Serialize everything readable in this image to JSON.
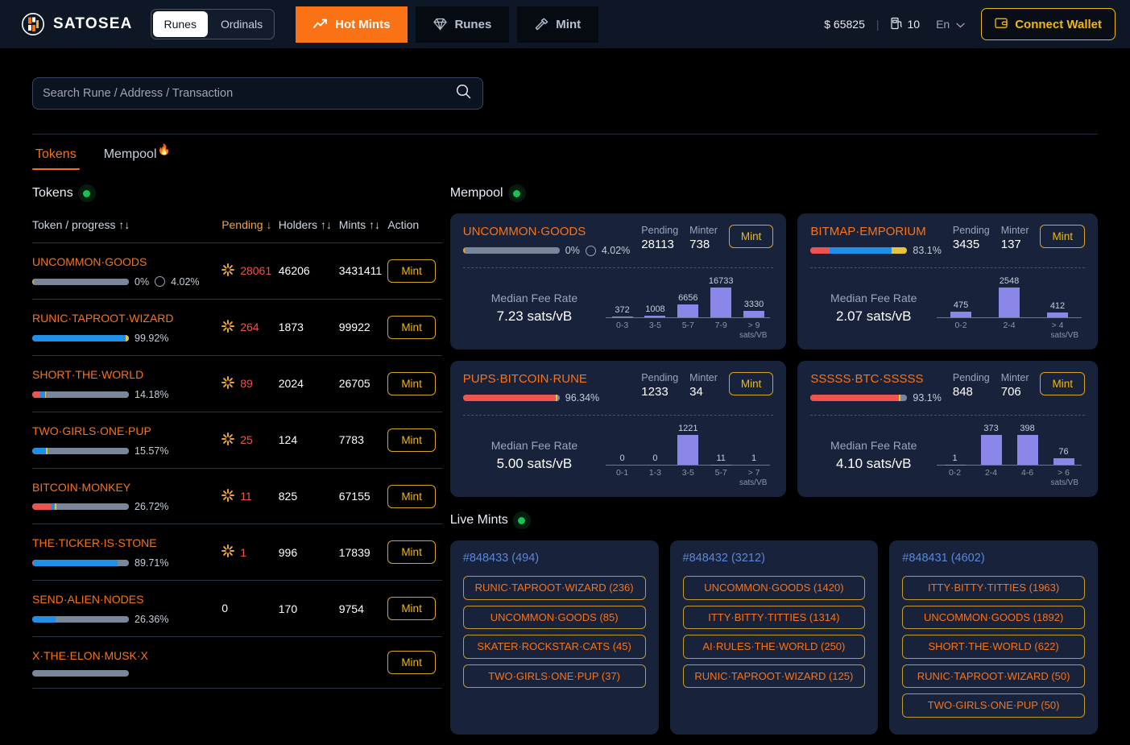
{
  "header": {
    "brand": "SATOSEA",
    "segments": [
      {
        "label": "Runes",
        "active": true
      },
      {
        "label": "Ordinals",
        "active": false
      }
    ],
    "nav": [
      {
        "label": "Hot Mints",
        "icon": "trend-up-icon",
        "active": true
      },
      {
        "label": "Runes",
        "icon": "diamond-icon",
        "active": false
      },
      {
        "label": "Mint",
        "icon": "hammer-icon",
        "active": false
      }
    ],
    "price": "$ 65825",
    "divider": "|",
    "gas": "10",
    "lang": "En",
    "wallet": "Connect Wallet",
    "accent": "#f97316",
    "wallet_color": "#f0b90b"
  },
  "search": {
    "placeholder": "Search Rune / Address / Transaction",
    "value": ""
  },
  "tabs": [
    {
      "label": "Tokens",
      "active": true,
      "flame": ""
    },
    {
      "label": "Mempool",
      "active": false,
      "flame": "🔥"
    }
  ],
  "tokens_panel": {
    "title": "Tokens",
    "columns": [
      {
        "label": "Token / progress",
        "sort": "↑↓",
        "sorted": false
      },
      {
        "label": "Pending",
        "sort": "↓",
        "sorted": true
      },
      {
        "label": "Holders",
        "sort": "↑↓",
        "sorted": false
      },
      {
        "label": "Mints",
        "sort": "↑↓",
        "sorted": false
      },
      {
        "label": "Action",
        "sort": "",
        "sorted": false
      }
    ],
    "action_label": "Mint",
    "rows": [
      {
        "name": "UNCOMMON·GOODS",
        "progress": "0%",
        "extra": "4.02%",
        "has_ring": true,
        "segments": [
          {
            "color": "#e8a33d",
            "pct": 1.5
          },
          {
            "color": "#7a8699",
            "pct": 98.5
          }
        ],
        "pending": "28061",
        "pending_zero": false,
        "holders": "46206",
        "mints": "3431411"
      },
      {
        "name": "RUNIC·TAPROOT·WIZARD",
        "progress": "99.92%",
        "extra": "",
        "has_ring": false,
        "segments": [
          {
            "color": "#1f8fe8",
            "pct": 97
          },
          {
            "color": "#e8c13d",
            "pct": 3
          }
        ],
        "pending": "264",
        "pending_zero": false,
        "holders": "1873",
        "mints": "99922"
      },
      {
        "name": "SHORT·THE·WORLD",
        "progress": "14.18%",
        "extra": "",
        "has_ring": false,
        "segments": [
          {
            "color": "#ef5350",
            "pct": 8
          },
          {
            "color": "#1f8fe8",
            "pct": 5
          },
          {
            "color": "#e8c13d",
            "pct": 1.5
          },
          {
            "color": "#7a8699",
            "pct": 85.5
          }
        ],
        "pending": "89",
        "pending_zero": false,
        "holders": "2024",
        "mints": "26705"
      },
      {
        "name": "TWO·GIRLS·ONE·PUP",
        "progress": "15.57%",
        "extra": "",
        "has_ring": false,
        "segments": [
          {
            "color": "#1f8fe8",
            "pct": 14
          },
          {
            "color": "#e8c13d",
            "pct": 2
          },
          {
            "color": "#7a8699",
            "pct": 84
          }
        ],
        "pending": "25",
        "pending_zero": false,
        "holders": "124",
        "mints": "7783"
      },
      {
        "name": "BITCOIN·MONKEY",
        "progress": "26.72%",
        "extra": "",
        "has_ring": false,
        "segments": [
          {
            "color": "#ef5350",
            "pct": 19
          },
          {
            "color": "#1f8fe8",
            "pct": 4
          },
          {
            "color": "#e8c13d",
            "pct": 2
          },
          {
            "color": "#7a8699",
            "pct": 75
          }
        ],
        "pending": "11",
        "pending_zero": false,
        "holders": "825",
        "mints": "67155"
      },
      {
        "name": "THE·TICKER·IS·STONE",
        "progress": "89.71%",
        "extra": "",
        "has_ring": false,
        "segments": [
          {
            "color": "#ef5350",
            "pct": 2
          },
          {
            "color": "#1f8fe8",
            "pct": 86
          },
          {
            "color": "#7a8699",
            "pct": 12
          }
        ],
        "pending": "1",
        "pending_zero": false,
        "holders": "996",
        "mints": "17839"
      },
      {
        "name": "SEND·ALIEN·NODES",
        "progress": "26.36%",
        "extra": "",
        "has_ring": false,
        "segments": [
          {
            "color": "#1f8fe8",
            "pct": 24
          },
          {
            "color": "#7a8699",
            "pct": 76
          }
        ],
        "pending": "0",
        "pending_zero": true,
        "holders": "170",
        "mints": "9754"
      },
      {
        "name": "X·THE·ELON·MUSK·X",
        "progress": "",
        "extra": "",
        "has_ring": false,
        "segments": [
          {
            "color": "#7a8699",
            "pct": 100
          }
        ],
        "pending": "",
        "pending_zero": true,
        "holders": "",
        "mints": ""
      }
    ]
  },
  "mempool_panel": {
    "title": "Mempool",
    "labels": {
      "pending": "Pending",
      "minter": "Minter",
      "mint": "Mint",
      "fee": "Median Fee Rate",
      "unit": "sats/VB"
    },
    "cards": [
      {
        "name": "UNCOMMON·GOODS",
        "pending": "28113",
        "minter": "738",
        "progress": "0%",
        "extra": "4.02%",
        "has_ring": true,
        "segments": [
          {
            "color": "#e8a33d",
            "pct": 1.5
          },
          {
            "color": "#7a8699",
            "pct": 98.5
          }
        ],
        "fee_rate": "7.23 sats/vB",
        "chart_data": {
          "type": "bar",
          "categories": [
            "0-3",
            "3-5",
            "5-7",
            "7-9",
            "> 9"
          ],
          "values": [
            372,
            1008,
            6656,
            16733,
            3330
          ],
          "title": "",
          "xlabel": "sats/VB",
          "ylabel": "",
          "ylim": [
            0,
            16733
          ]
        }
      },
      {
        "name": "BITMAP·EMPORIUM",
        "pending": "3435",
        "minter": "137",
        "progress": "83.1%",
        "extra": "",
        "has_ring": false,
        "segments": [
          {
            "color": "#ef5350",
            "pct": 20
          },
          {
            "color": "#1f8fe8",
            "pct": 64
          },
          {
            "color": "#e8c13d",
            "pct": 16
          }
        ],
        "fee_rate": "2.07 sats/vB",
        "chart_data": {
          "type": "bar",
          "categories": [
            "0-2",
            "2-4",
            "> 4"
          ],
          "values": [
            475,
            2548,
            412
          ],
          "title": "",
          "xlabel": "sats/VB",
          "ylabel": "",
          "ylim": [
            0,
            2548
          ]
        }
      },
      {
        "name": "PUPS·BITCOIN·RUNE",
        "pending": "1233",
        "minter": "34",
        "progress": "96.34%",
        "extra": "",
        "has_ring": false,
        "segments": [
          {
            "color": "#ef5350",
            "pct": 96
          },
          {
            "color": "#e8c13d",
            "pct": 2
          },
          {
            "color": "#7a8699",
            "pct": 2
          }
        ],
        "fee_rate": "5.00 sats/vB",
        "chart_data": {
          "type": "bar",
          "categories": [
            "0-1",
            "1-3",
            "3-5",
            "5-7",
            "> 7"
          ],
          "values": [
            0,
            0,
            1221,
            11,
            1
          ],
          "title": "",
          "xlabel": "sats/VB",
          "ylabel": "",
          "ylim": [
            0,
            1221
          ]
        }
      },
      {
        "name": "SSSSS·BTC·SSSSS",
        "pending": "848",
        "minter": "706",
        "progress": "93.1%",
        "extra": "",
        "has_ring": false,
        "segments": [
          {
            "color": "#ef5350",
            "pct": 91
          },
          {
            "color": "#e8c13d",
            "pct": 2
          },
          {
            "color": "#7a8699",
            "pct": 7
          }
        ],
        "fee_rate": "4.10 sats/vB",
        "chart_data": {
          "type": "bar",
          "categories": [
            "0-2",
            "2-4",
            "4-6",
            "> 6"
          ],
          "values": [
            1,
            373,
            398,
            76
          ],
          "title": "",
          "xlabel": "sats/VB",
          "ylabel": "",
          "ylim": [
            0,
            398
          ]
        }
      }
    ]
  },
  "live_mints": {
    "title": "Live Mints",
    "blocks": [
      {
        "header": "#848433 (494)",
        "items": [
          "RUNIC·TAPROOT·WIZARD (236)",
          "UNCOMMON·GOODS (85)",
          "SKATER·ROCKSTAR·CATS (45)",
          "TWO·GIRLS·ONE·PUP (37)"
        ]
      },
      {
        "header": "#848432 (3212)",
        "items": [
          "UNCOMMON·GOODS (1420)",
          "ITTY·BITTY·TITTIES (1314)",
          "AI·RULES·THE·WORLD (250)",
          "RUNIC·TAPROOT·WIZARD (125)"
        ]
      },
      {
        "header": "#848431 (4602)",
        "items": [
          "ITTY·BITTY·TITTIES (1963)",
          "UNCOMMON·GOODS (1892)",
          "SHORT·THE·WORLD (622)",
          "RUNIC·TAPROOT·WIZARD (50)",
          "TWO·GIRLS·ONE·PUP (50)"
        ]
      }
    ]
  }
}
